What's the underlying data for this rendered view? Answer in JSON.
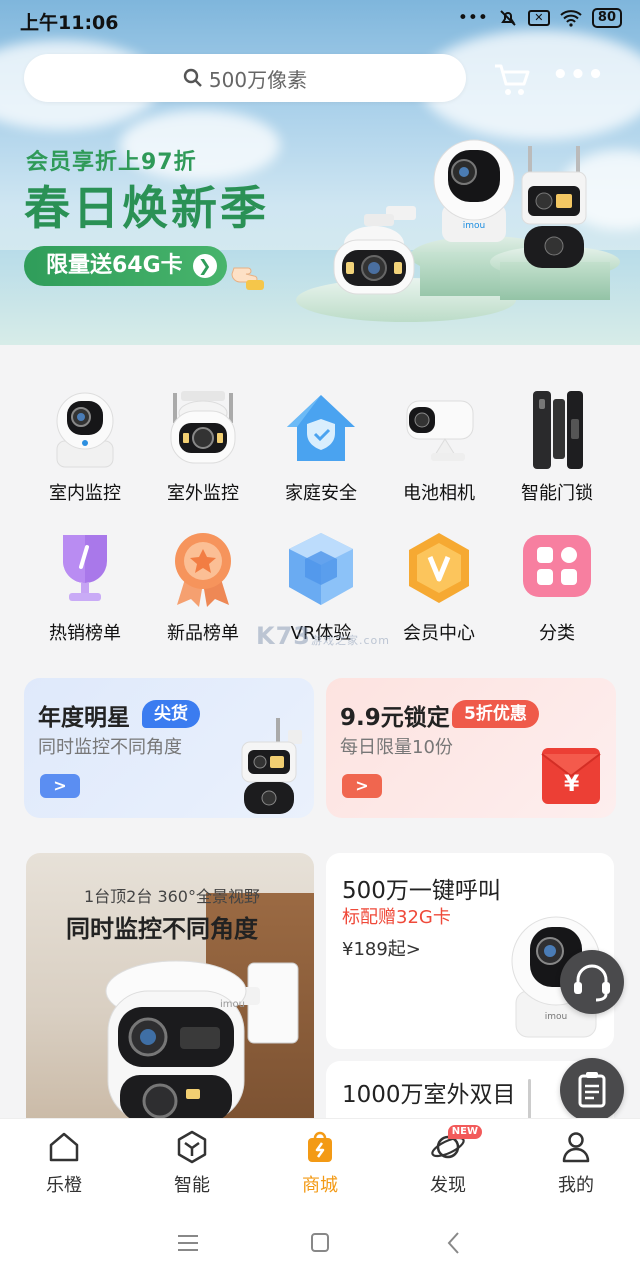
{
  "status_bar": {
    "time": "上午11:06",
    "battery": "80",
    "icons": [
      "dots-icon",
      "mute-icon",
      "sim-off-icon",
      "wifi-icon",
      "battery-icon"
    ]
  },
  "search": {
    "placeholder": "500万像素"
  },
  "hero": {
    "subtitle": "会员享折上97折",
    "title": "春日焕新季",
    "cta": "限量送64G卡",
    "brand_text": "imou",
    "colors": {
      "title": "#2a9155",
      "pill": "#2f9d5a"
    }
  },
  "categories": [
    {
      "label": "室内监控",
      "icon": "indoor-camera-icon"
    },
    {
      "label": "室外监控",
      "icon": "outdoor-camera-icon"
    },
    {
      "label": "家庭安全",
      "icon": "home-shield-icon"
    },
    {
      "label": "电池相机",
      "icon": "battery-camera-icon"
    },
    {
      "label": "智能门锁",
      "icon": "smart-lock-icon"
    },
    {
      "label": "热销榜单",
      "icon": "trophy-icon"
    },
    {
      "label": "新品榜单",
      "icon": "medal-icon"
    },
    {
      "label": "VR体验",
      "icon": "vr-cube-icon"
    },
    {
      "label": "会员中心",
      "icon": "vip-hexagon-icon"
    },
    {
      "label": "分类",
      "icon": "grid-icon"
    }
  ],
  "promos": [
    {
      "title": "年度明星",
      "tag": "尖货",
      "subtitle": "同时监控不同角度",
      "arrow": ">"
    },
    {
      "title": "9.9元锁定",
      "tag": "5折优惠",
      "subtitle": "每日限量10份",
      "arrow": ">",
      "envelope_symbol": "¥"
    }
  ],
  "feed": {
    "left": {
      "line1": "1台顶2台 360°全景视野",
      "line2": "同时监控不同角度",
      "brand_text": "imou"
    },
    "right1": {
      "title": "500万一键呼叫",
      "badge": "标配赠32G卡",
      "price": "¥189起>",
      "brand_text": "imou"
    },
    "right2": {
      "title": "1000万室外双目"
    }
  },
  "floating": [
    "headset-icon",
    "clipboard-icon"
  ],
  "tabs": [
    {
      "label": "乐橙",
      "icon": "home-icon",
      "active": false
    },
    {
      "label": "智能",
      "icon": "cube-icon",
      "active": false
    },
    {
      "label": "商城",
      "icon": "shopping-bag-icon",
      "active": true
    },
    {
      "label": "发现",
      "icon": "planet-icon",
      "active": false,
      "badge": "NEW"
    },
    {
      "label": "我的",
      "icon": "person-icon",
      "active": false
    }
  ],
  "watermark": {
    "main": "K73",
    "sub1": "游戏之家",
    "sub2": ".com"
  },
  "accent_color": "#f39a15"
}
